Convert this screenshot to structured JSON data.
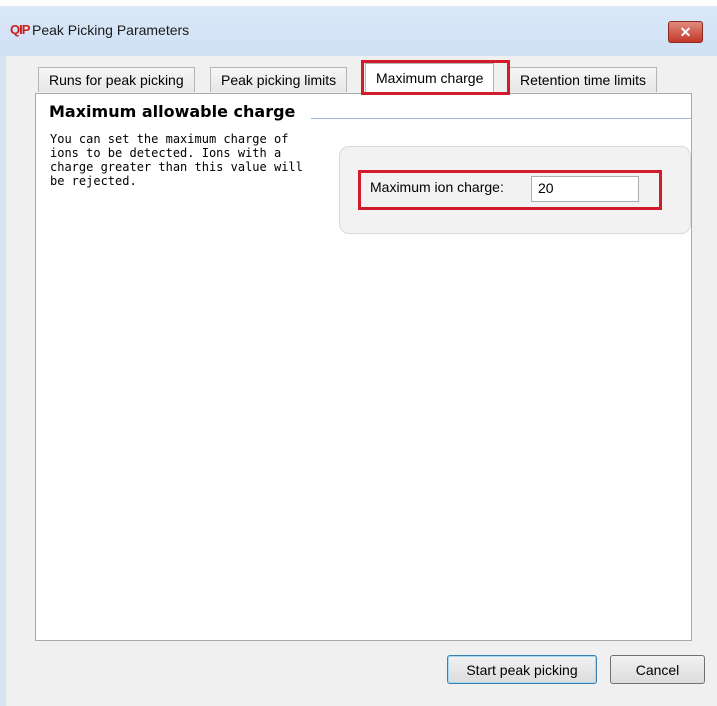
{
  "window": {
    "logo_text": "QIP",
    "title": "Peak Picking Parameters",
    "close_symbol": "✕"
  },
  "tabs": [
    {
      "label": "Runs for peak picking",
      "active": false
    },
    {
      "label": "Peak picking limits",
      "active": false
    },
    {
      "label": "Maximum charge",
      "active": true
    },
    {
      "label": "Retention time limits",
      "active": false
    }
  ],
  "panel": {
    "section_title": "Maximum allowable charge",
    "description": "You can set the maximum charge of ions to be detected. Ions with a charge greater than this value will be rejected.",
    "field": {
      "label": "Maximum ion charge:",
      "value": "20"
    }
  },
  "buttons": {
    "start": "Start peak picking",
    "cancel": "Cancel"
  },
  "colors": {
    "highlight": "#d21b2b",
    "title_bar": "#dbe8f8",
    "close_button": "#c4382b"
  }
}
